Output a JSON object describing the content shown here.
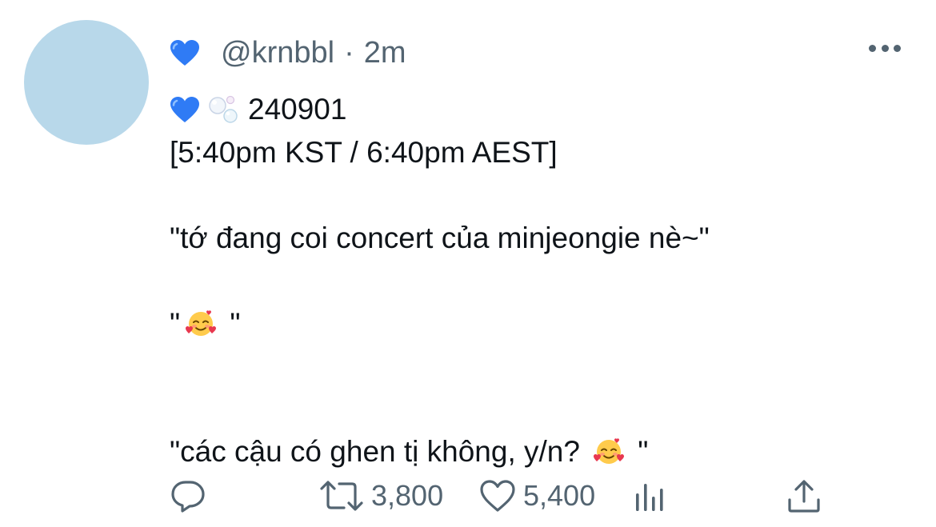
{
  "tweet": {
    "handle": "@krnbbl",
    "separator": "·",
    "time": "2m",
    "lines": {
      "date": "240901",
      "times": "[5:40pm KST / 6:40pm AEST]",
      "quote1": "\"tớ đang coi concert của minjeongie nè~\"",
      "quote2_open": "\"",
      "quote2_close": " \"",
      "quote3": "\"các cậu có ghen tị không, y/n?",
      "quote3_close": " \""
    }
  },
  "actions": {
    "retweets": "3,800",
    "likes": "5,400"
  },
  "colors": {
    "avatar": "#b8d8ea",
    "secondary_text": "#536471",
    "blue_heart": "#2f7bf5"
  },
  "icons": [
    "blue-heart-icon",
    "bubbles-icon",
    "smiling-face-hearts-icon",
    "reply-icon",
    "retweet-icon",
    "like-icon",
    "analytics-icon",
    "share-icon",
    "more-icon"
  ]
}
